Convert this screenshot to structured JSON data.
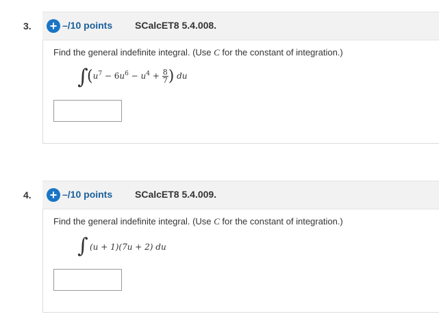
{
  "questions": [
    {
      "number": "3.",
      "plus_icon": "plus-circle-icon",
      "plus_symbol": "+",
      "points": "–/10 points",
      "code": "SCalcET8 5.4.008.",
      "prompt_before": "Find the general indefinite integral. (Use ",
      "prompt_var": "C",
      "prompt_after": " for the constant of integration.)",
      "integral_sign": "∫",
      "expression": {
        "open": "(",
        "term1": "u",
        "exp1": "7",
        "minus1": " − 6",
        "term2": "u",
        "exp2": "6",
        "minus2": " − ",
        "term3": "u",
        "exp3": "4",
        "plus": " + ",
        "frac_num": "8",
        "frac_den": "7",
        "close": ")",
        "differential": "du"
      },
      "answer_value": ""
    },
    {
      "number": "4.",
      "plus_icon": "plus-circle-icon",
      "plus_symbol": "+",
      "points": "–/10 points",
      "code": "SCalcET8 5.4.009.",
      "prompt_before": "Find the general indefinite integral. (Use ",
      "prompt_var": "C",
      "prompt_after": " for the constant of integration.)",
      "integral_sign": "∫",
      "expression_text": "(u + 1)(7u + 2) du",
      "answer_value": ""
    }
  ]
}
